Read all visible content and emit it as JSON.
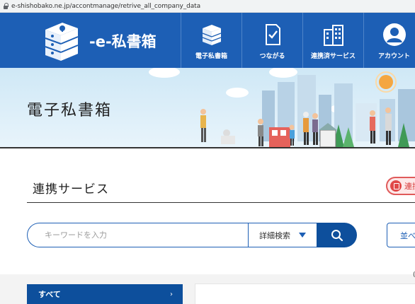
{
  "browser": {
    "url": "e-shishobako.ne.jp/accontmanage/retrive_all_company_data"
  },
  "header": {
    "logo_text": "-e-私書箱",
    "nav": [
      {
        "label": "電子私書箱",
        "icon": "cabinet-icon"
      },
      {
        "label": "つながる",
        "icon": "document-check-icon"
      },
      {
        "label": "連携済サービス",
        "icon": "building-icon"
      },
      {
        "label": "アカウント",
        "icon": "user-icon"
      }
    ],
    "brand_color": "#1d5fb5"
  },
  "hero": {
    "title": "電子私書箱"
  },
  "section": {
    "title": "連携サービス",
    "badge_label": "連携"
  },
  "search": {
    "placeholder": "キーワードを入力",
    "advanced_label": "詳細検索",
    "sort_label": "並べ"
  },
  "categories": {
    "selected": "すべて"
  },
  "misc": {
    "edge_mark": "("
  }
}
